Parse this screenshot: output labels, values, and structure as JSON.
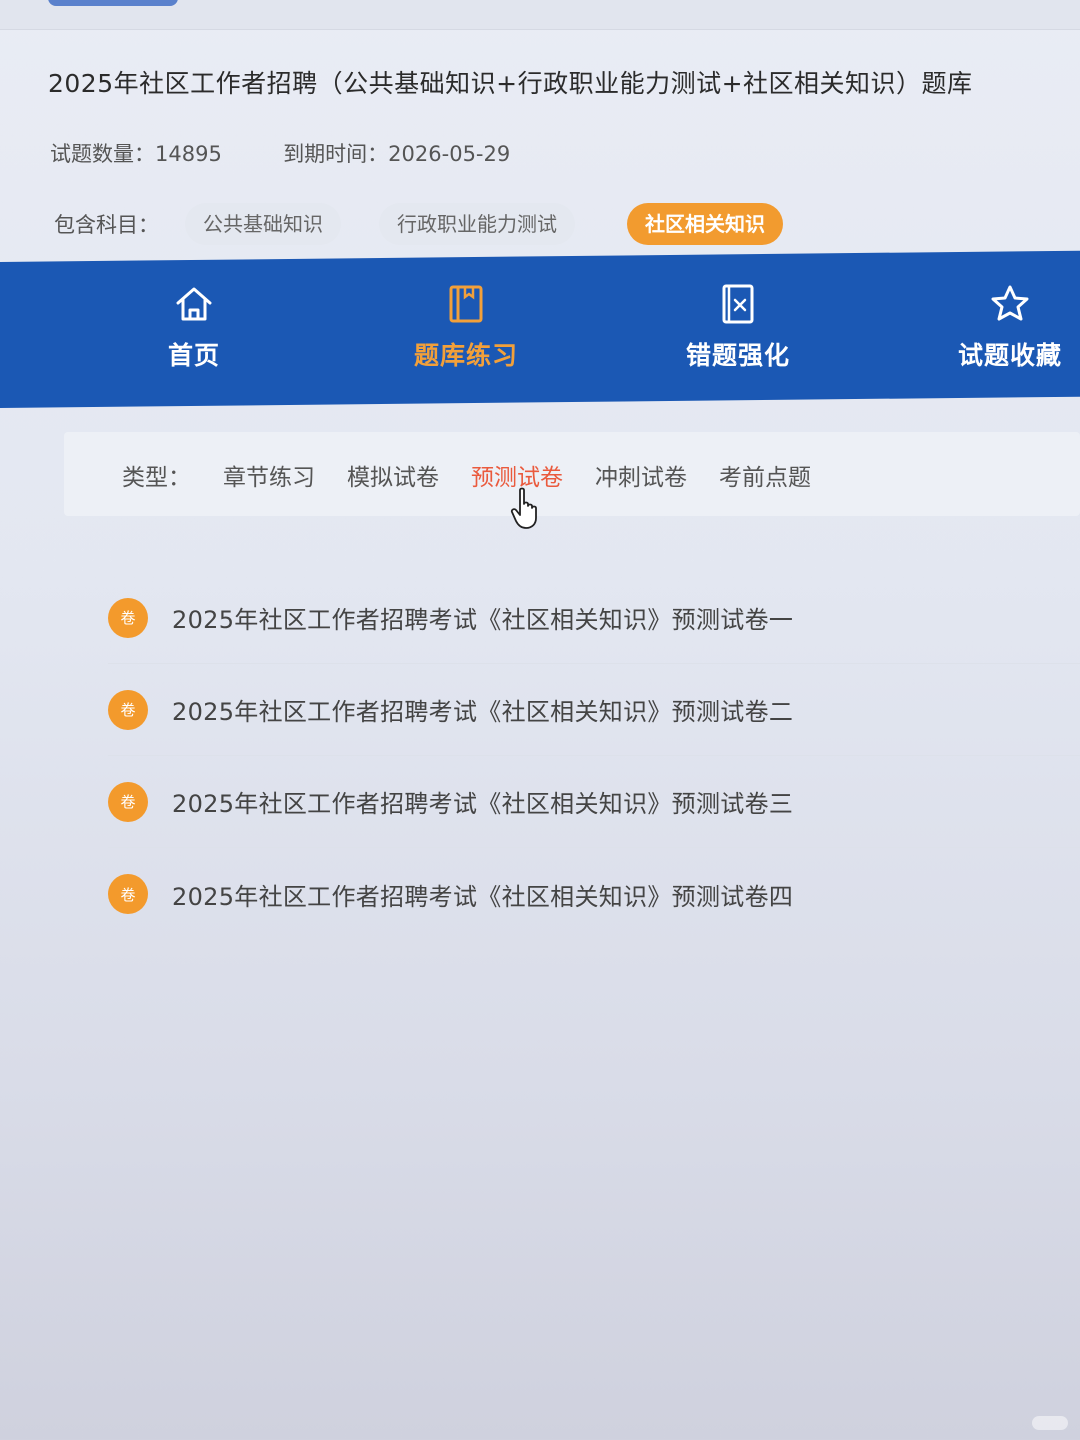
{
  "course": {
    "title": "2025年社区工作者招聘（公共基础知识+行政职业能力测试+社区相关知识）题库",
    "question_count_label": "试题数量：14895",
    "expiry_label": "到期时间：2026-05-29",
    "subjects_label": "包含科目：",
    "subjects": [
      {
        "name": "公共基础知识",
        "active": false
      },
      {
        "name": "行政职业能力测试",
        "active": false
      },
      {
        "name": "社区相关知识",
        "active": true
      }
    ]
  },
  "nav": {
    "items": [
      {
        "label": "首页",
        "icon": "home-icon",
        "active": false
      },
      {
        "label": "题库练习",
        "icon": "book-icon",
        "active": true
      },
      {
        "label": "错题强化",
        "icon": "wrong-question-icon",
        "active": false
      },
      {
        "label": "试题收藏",
        "icon": "star-icon",
        "active": false
      }
    ]
  },
  "filter": {
    "label": "类型：",
    "options": [
      {
        "label": "章节练习",
        "active": false
      },
      {
        "label": "模拟试卷",
        "active": false
      },
      {
        "label": "预测试卷",
        "active": true
      },
      {
        "label": "冲刺试卷",
        "active": false
      },
      {
        "label": "考前点题",
        "active": false
      }
    ]
  },
  "papers": {
    "badge_text": "卷",
    "items": [
      "2025年社区工作者招聘考试《社区相关知识》预测试卷一",
      "2025年社区工作者招聘考试《社区相关知识》预测试卷二",
      "2025年社区工作者招聘考试《社区相关知识》预测试卷三",
      "2025年社区工作者招聘考试《社区相关知识》预测试卷四"
    ]
  },
  "colors": {
    "nav_bg": "#1b58b4",
    "accent_orange": "#f29b2f",
    "active_filter": "#ea5a3d"
  }
}
